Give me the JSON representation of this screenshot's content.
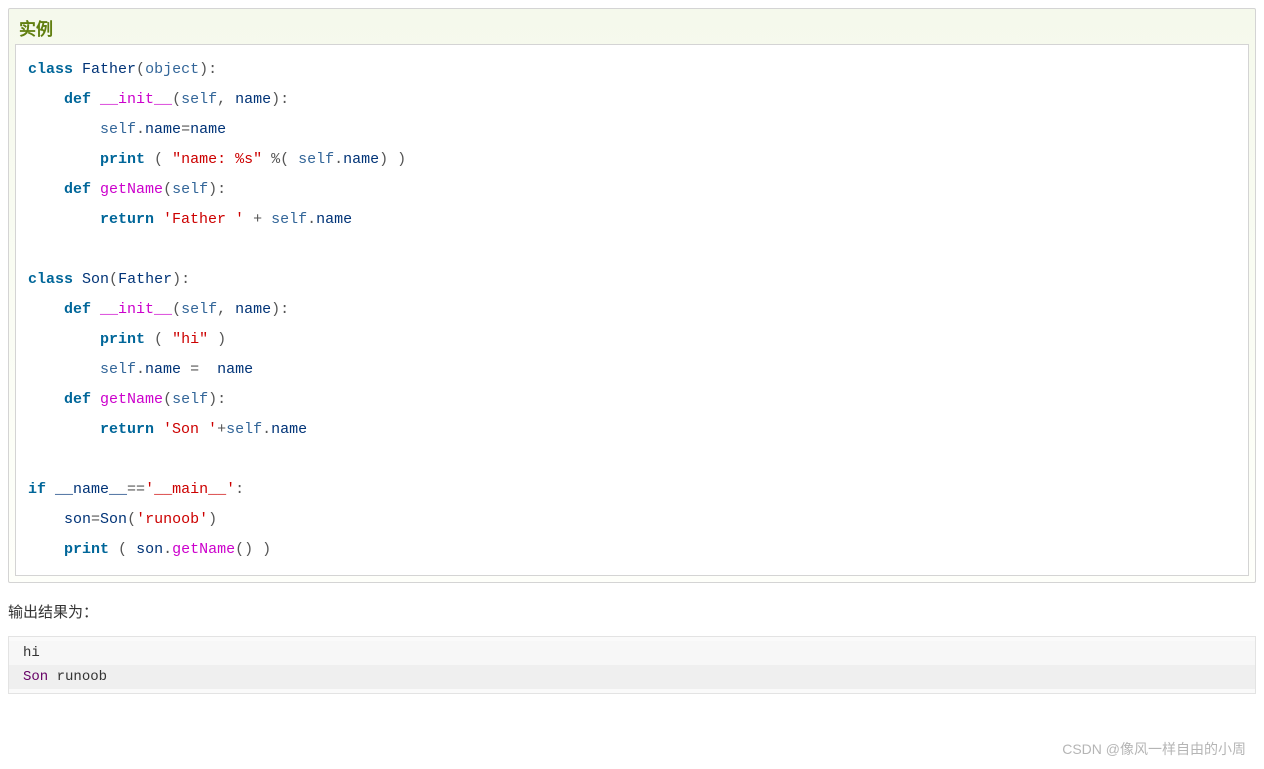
{
  "example": {
    "title": "实例",
    "code": {
      "line1": {
        "kw_class": "class",
        "name_father": "Father",
        "p_open": "(",
        "builtin_object": "object",
        "p_close": ")",
        "colon": ":"
      },
      "line2": {
        "indent": "    ",
        "kw_def": "def",
        "sp": " ",
        "func_init": "__init__",
        "p_open": "(",
        "arg_self": "self",
        "comma": ", ",
        "arg_name": "name",
        "p_close": ")",
        "colon": ":"
      },
      "line3": {
        "indent": "        ",
        "self": "self",
        "dot": ".",
        "attr": "name",
        "eq": "=",
        "rhs": "name"
      },
      "line4": {
        "indent": "        ",
        "print": "print",
        "sp": " ",
        "p_open": "( ",
        "str": "\"name: %s\"",
        "mod": " %( ",
        "self": "self",
        "dot": ".",
        "attr": "name",
        "close": ") )"
      },
      "line5": {
        "indent": "    ",
        "kw_def": "def",
        "sp": " ",
        "func": "getName",
        "p_open": "(",
        "arg_self": "self",
        "p_close": ")",
        "colon": ":"
      },
      "line6": {
        "indent": "        ",
        "kw_return": "return",
        "sp": " ",
        "str": "'Father '",
        "plus": " + ",
        "self": "self",
        "dot": ".",
        "attr": "name"
      },
      "line7": "",
      "line8": {
        "kw_class": "class",
        "sp": " ",
        "name_son": "Son",
        "p_open": "(",
        "name_father": "Father",
        "p_close": ")",
        "colon": ":"
      },
      "line9": {
        "indent": "    ",
        "kw_def": "def",
        "sp": " ",
        "func_init": "__init__",
        "p_open": "(",
        "arg_self": "self",
        "comma": ", ",
        "arg_name": "name",
        "p_close": ")",
        "colon": ":"
      },
      "line10": {
        "indent": "        ",
        "print": "print",
        "sp": " ",
        "p_open": "( ",
        "str": "\"hi\"",
        "close": " )"
      },
      "line11": {
        "indent": "        ",
        "self": "self",
        "dot": ".",
        "attr": "name",
        "eq": " =  ",
        "rhs": "name"
      },
      "line12": {
        "indent": "    ",
        "kw_def": "def",
        "sp": " ",
        "func": "getName",
        "p_open": "(",
        "arg_self": "self",
        "p_close": ")",
        "colon": ":"
      },
      "line13": {
        "indent": "        ",
        "kw_return": "return",
        "sp": " ",
        "str": "'Son '",
        "plus": "+",
        "self": "self",
        "dot": ".",
        "attr": "name"
      },
      "line14": "",
      "line15": {
        "kw_if": "if",
        "sp": " ",
        "dname": "__name__",
        "eq": "==",
        "str": "'__main__'",
        "colon": ":"
      },
      "line16": {
        "indent": "    ",
        "var": "son",
        "eq": "=",
        "cls": "Son",
        "p_open": "(",
        "str": "'runoob'",
        "p_close": ")"
      },
      "line17": {
        "indent": "    ",
        "print": "print",
        "sp": " ",
        "p_open": "( ",
        "var": "son",
        "dot": ".",
        "func": "getName",
        "call": "()",
        "close": " )"
      }
    }
  },
  "result_label": "输出结果为：",
  "output": {
    "line1": "hi",
    "line2_prefix": "Son",
    "line2_rest": " runoob"
  },
  "watermark": "CSDN @像风一样自由的小周"
}
